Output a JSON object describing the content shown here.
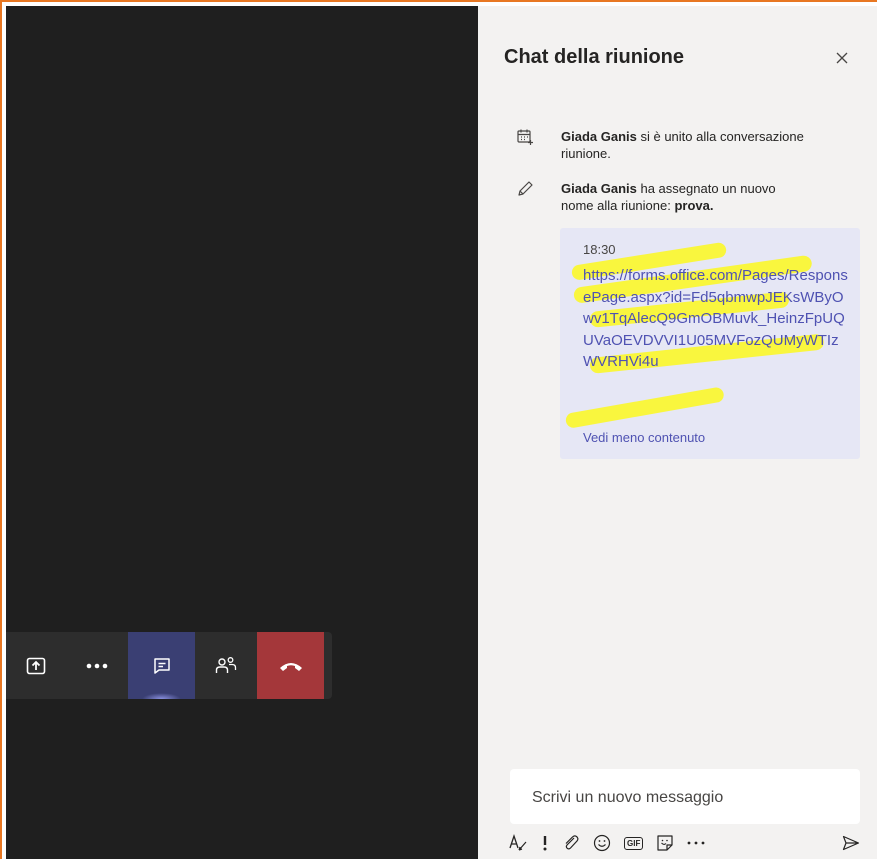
{
  "toolbar": {
    "share_icon": "share-screen-icon",
    "more_icon": "more-actions-icon",
    "chat_icon": "chat-icon",
    "participants_icon": "participants-icon",
    "hangup_icon": "hang-up-icon",
    "colors": {
      "bar": "#2d2d2d",
      "active": "#3a3f73",
      "hangup": "#a4373a"
    }
  },
  "chat": {
    "title": "Chat della riunione",
    "close_icon": "close-icon",
    "events": [
      {
        "icon": "calendar-join-icon",
        "name": "Giada Ganis",
        "text": " si è unito alla conversazione riunione."
      },
      {
        "icon": "pencil-icon",
        "name": "Giada Ganis",
        "text": " ha assegnato un nuovo nome alla riunione: ",
        "bold": "prova."
      }
    ],
    "message": {
      "time": "18:30",
      "link": "https://forms.office.com/Pages/ResponsePage.aspx?id=Fd5qbmwpJEKsWByOwv1TqAlecQ9GmOBMuvk_HeinzFpUQUVaOEVDVVI1U05MVFozQUMyWTIzWVRHVi4u",
      "show_less": "Vedi meno contenuto"
    },
    "compose": {
      "placeholder": "Scrivi un nuovo messaggio",
      "value": ""
    },
    "compose_tools": [
      "format-icon",
      "important-icon",
      "attach-icon",
      "emoji-icon",
      "gif-icon",
      "sticker-icon",
      "more-options-icon",
      "send-icon"
    ],
    "gif_label": "GIF",
    "highlight_color": "#fffb00"
  }
}
